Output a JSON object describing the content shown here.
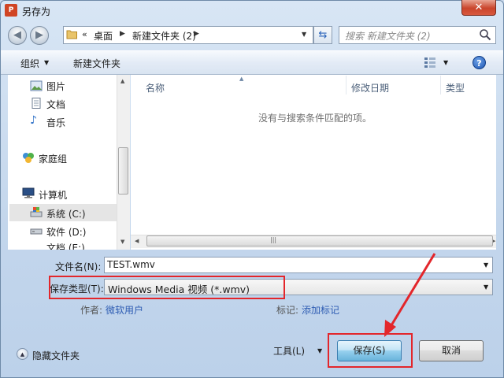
{
  "window": {
    "title": "另存为",
    "app_icon_text": "P",
    "close_glyph": "✕"
  },
  "nav": {
    "back_glyph": "◀",
    "forward_glyph": "▶",
    "address": {
      "chevron": "«",
      "breadcrumbs": [
        "桌面",
        "新建文件夹 (2)"
      ]
    },
    "search_placeholder": "搜索 新建文件夹 (2)"
  },
  "toolbar": {
    "organize_label": "组织",
    "new_folder_label": "新建文件夹",
    "help_glyph": "?"
  },
  "sidebar": {
    "items": [
      {
        "label": "图片",
        "icon": "pictures-icon"
      },
      {
        "label": "文档",
        "icon": "documents-icon"
      },
      {
        "label": "音乐",
        "icon": "music-icon"
      },
      {
        "label": "家庭组",
        "icon": "homegroup-icon"
      },
      {
        "label": "计算机",
        "icon": "computer-icon"
      },
      {
        "label": "系统 (C:)",
        "icon": "drive-c-icon",
        "selected": true
      },
      {
        "label": "软件 (D:)",
        "icon": "drive-d-icon"
      },
      {
        "label": "文档 (E:)",
        "icon": "drive-e-icon"
      }
    ]
  },
  "file_list": {
    "columns": [
      "名称",
      "修改日期",
      "类型"
    ],
    "empty_message": "没有与搜索条件匹配的项。"
  },
  "form": {
    "filename_label": "文件名(N):",
    "filename_value": "TEST.wmv",
    "filetype_label": "保存类型(T):",
    "filetype_value": "Windows Media 视频 (*.wmv)",
    "author_label": "作者:",
    "author_value": "微软用户",
    "tags_label": "标记:",
    "tags_value": "添加标记"
  },
  "footer": {
    "hide_folders_label": "隐藏文件夹",
    "tools_label": "工具(L)",
    "save_label": "保存(S)",
    "cancel_label": "取消"
  },
  "annotation_color": "#e3262b"
}
